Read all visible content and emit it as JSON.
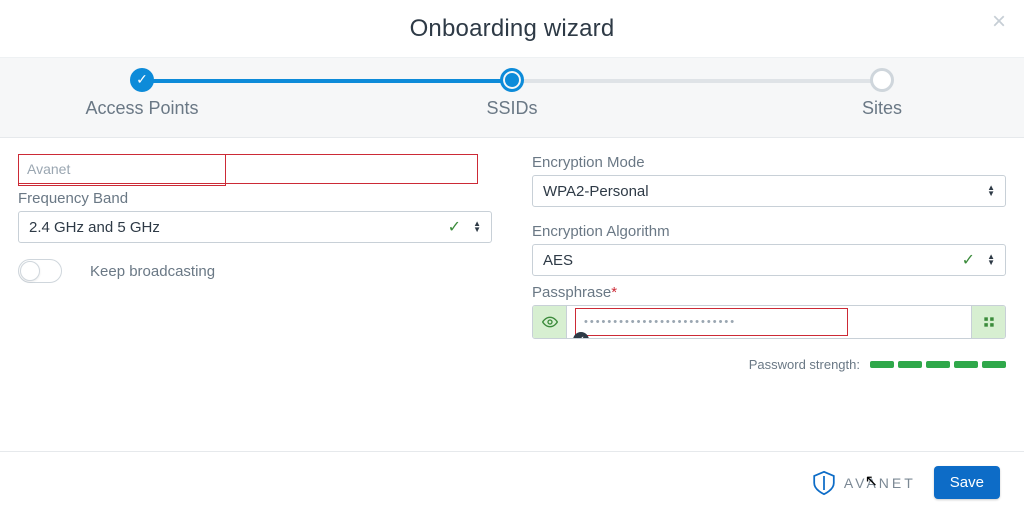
{
  "header": {
    "title": "Onboarding wizard"
  },
  "steps": {
    "s1": "Access Points",
    "s2": "SSIDs",
    "s3": "Sites"
  },
  "left": {
    "ssid_value": "Avanet",
    "freq_label": "Frequency Band",
    "freq_value": "2.4 GHz and 5 GHz",
    "broadcast_label": "Keep broadcasting"
  },
  "right": {
    "enc_mode_label": "Encryption Mode",
    "enc_mode_value": "WPA2-Personal",
    "enc_algo_label": "Encryption Algorithm",
    "enc_algo_value": "AES",
    "pass_label": "Passphrase",
    "pass_dots": "••••••••••••••••••••••••••",
    "strength_label": "Password strength:"
  },
  "footer": {
    "brand": "AVANET",
    "save": "Save"
  }
}
